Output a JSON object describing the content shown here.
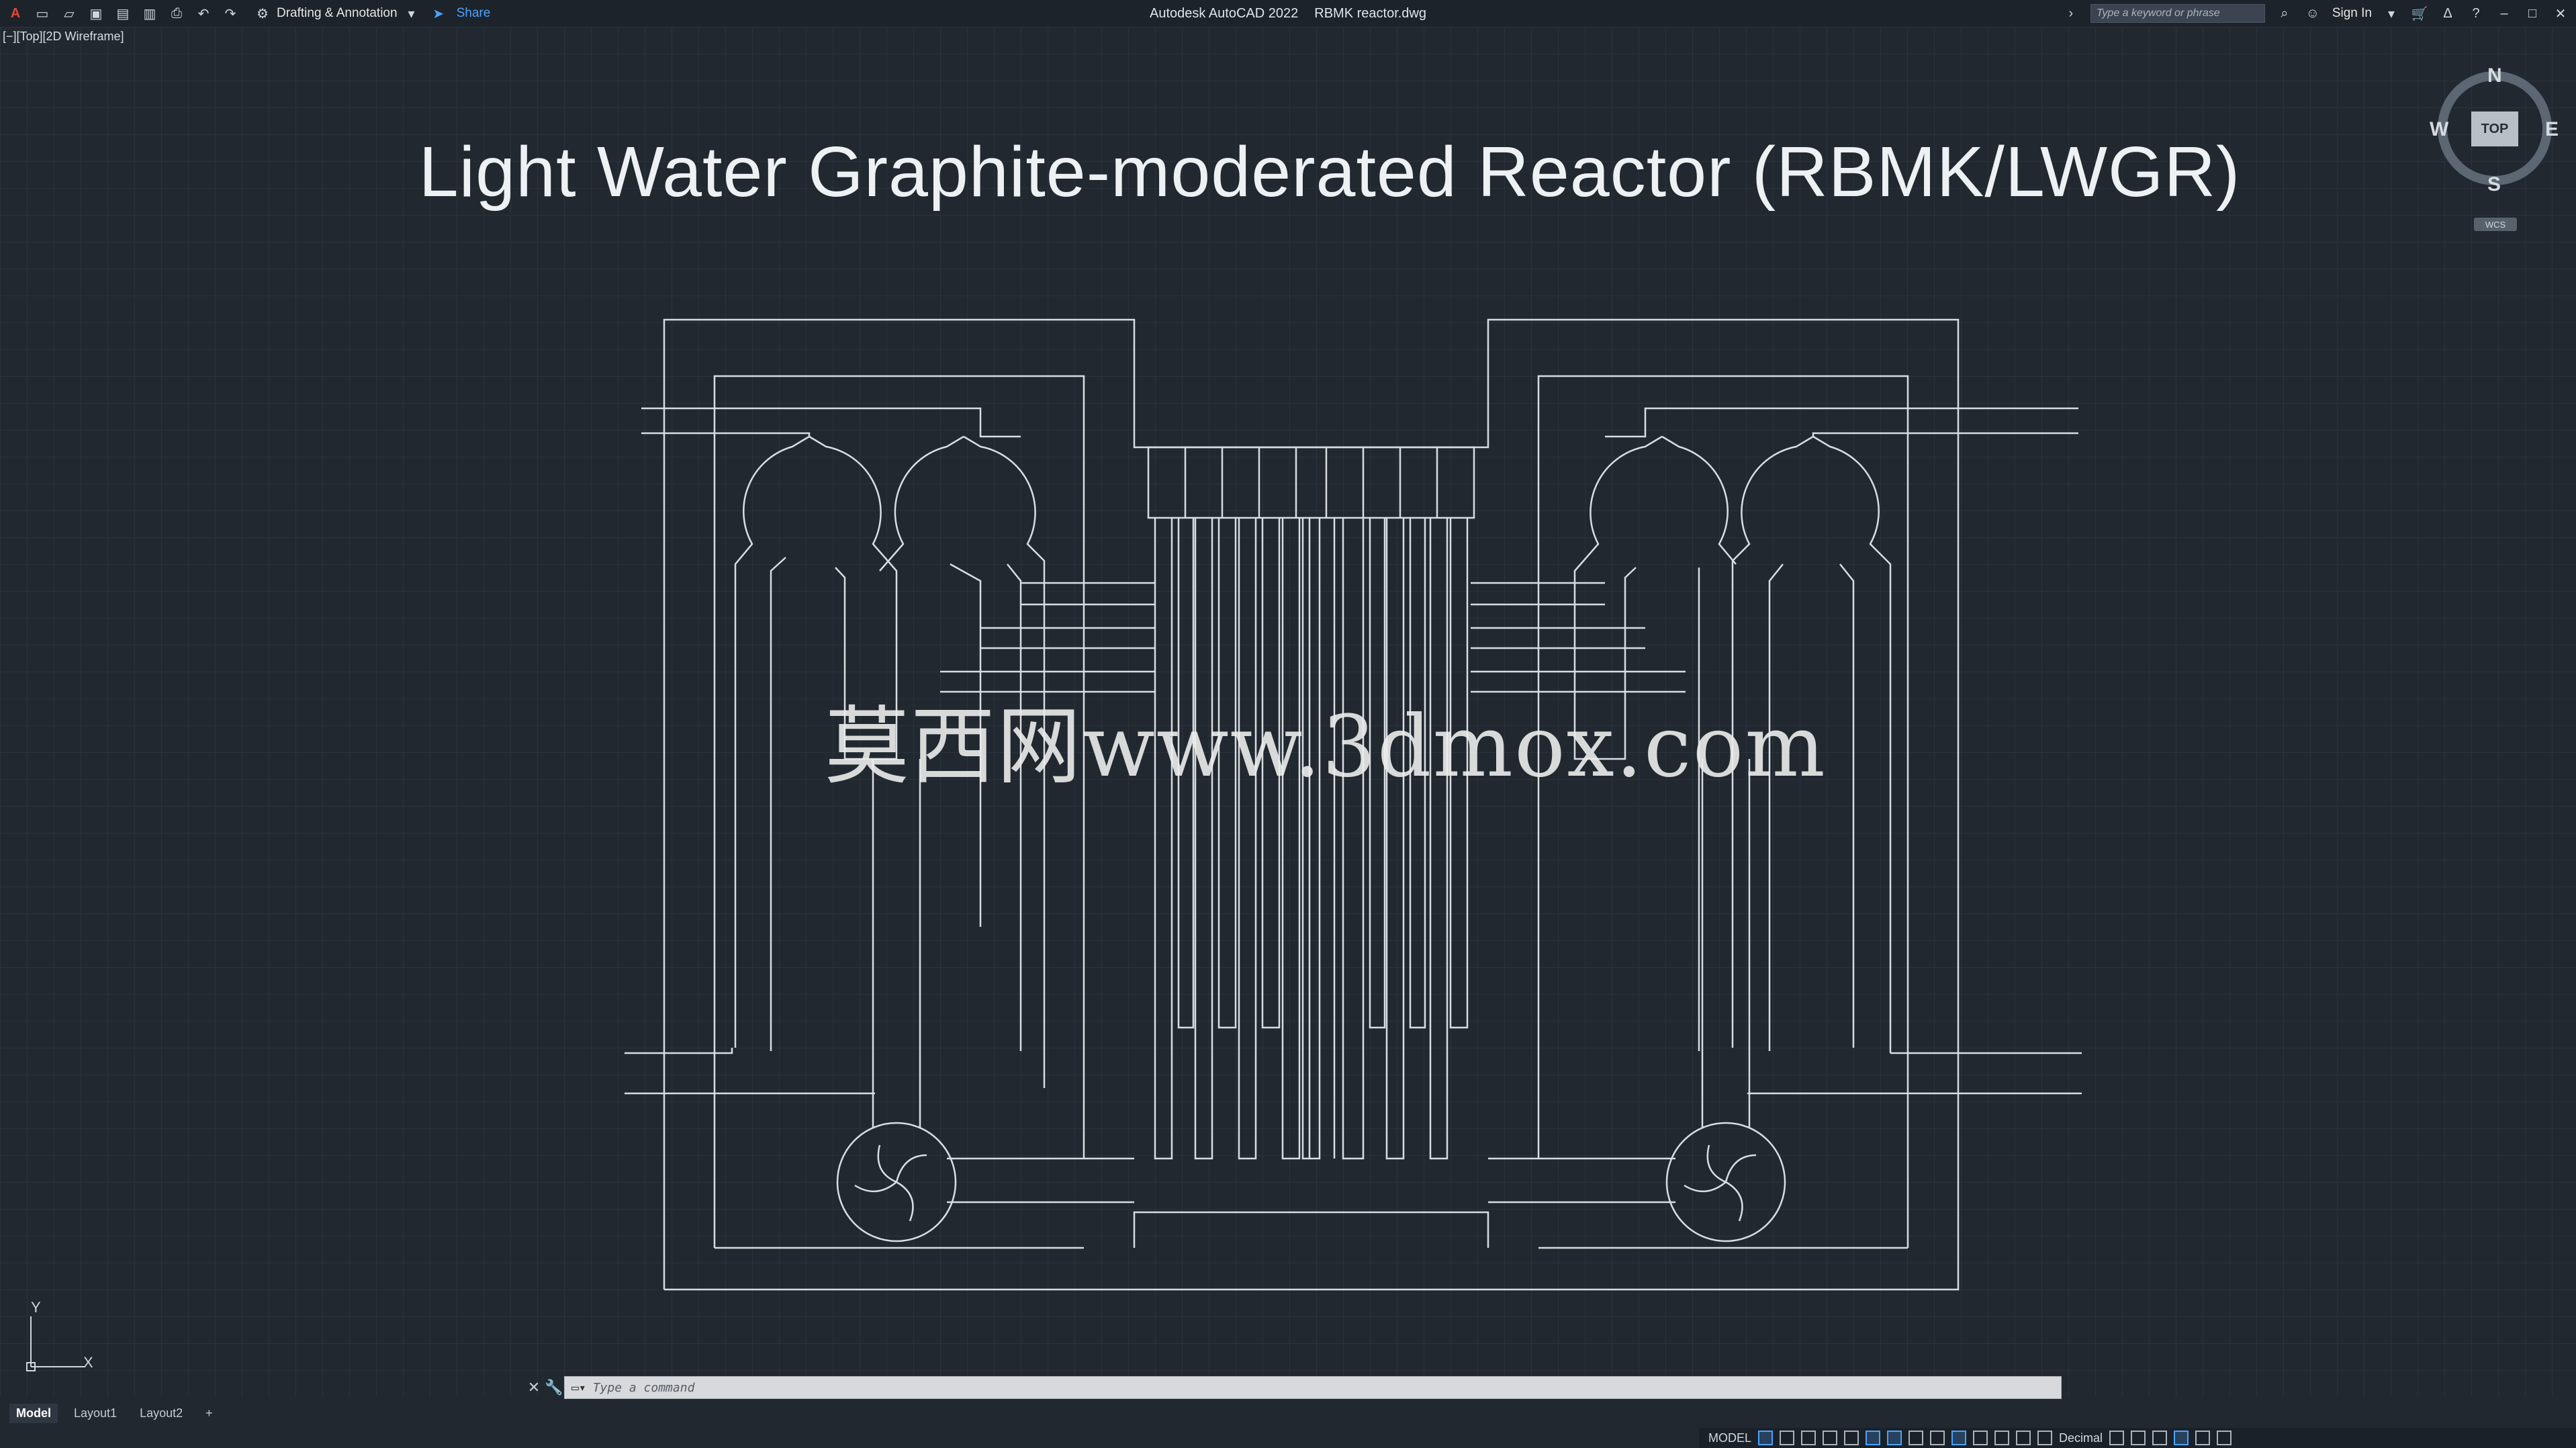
{
  "app": {
    "title": "Autodesk AutoCAD 2022",
    "filename": "RBMK reactor.dwg",
    "workspace": "Drafting & Annotation",
    "share_label": "Share",
    "search_placeholder": "Type a keyword or phrase",
    "sign_in": "Sign In"
  },
  "viewport": {
    "label": "[−][Top][2D Wireframe]"
  },
  "drawing": {
    "title": "Light Water Graphite-moderated Reactor (RBMK/LWGR)",
    "watermark": "莫西网www.3dmox.com"
  },
  "viewcube": {
    "north": "N",
    "south": "S",
    "east": "E",
    "west": "W",
    "top_face": "TOP",
    "wcs": "WCS"
  },
  "ucs": {
    "x": "X",
    "y": "Y"
  },
  "command": {
    "placeholder": "Type a command"
  },
  "tabs": [
    "Model",
    "Layout1",
    "Layout2"
  ],
  "status": {
    "model": "MODEL",
    "units": "Decimal"
  },
  "colors": {
    "background": "#212830",
    "lines": "#d9dde2",
    "accent": "#4aa3ff"
  }
}
